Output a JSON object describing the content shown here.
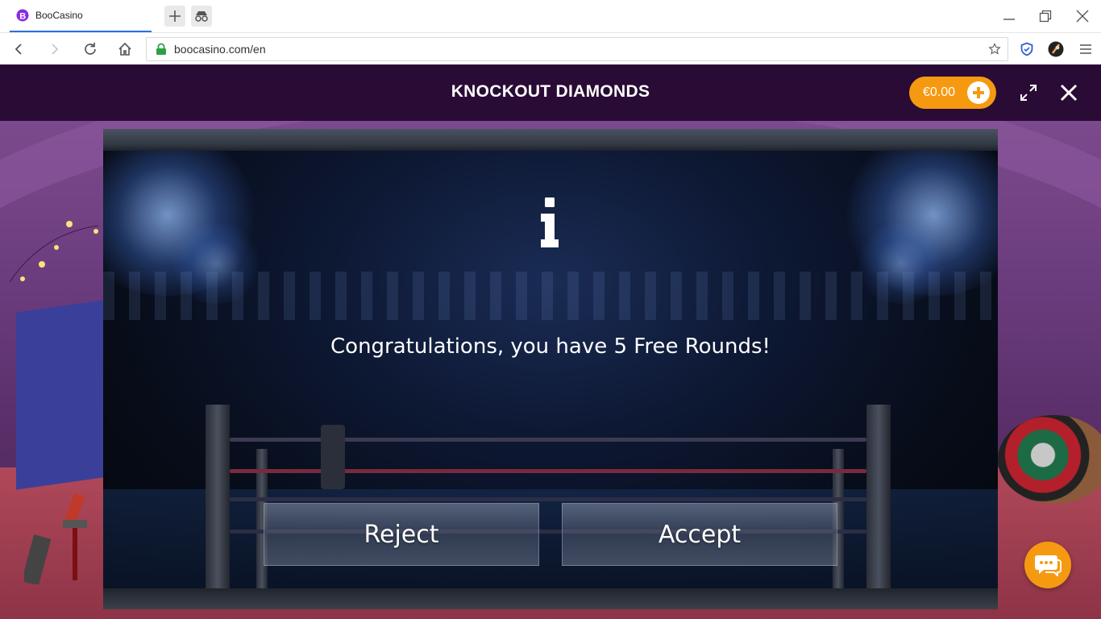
{
  "browser": {
    "tab_title": "BooCasino",
    "url": "boocasino.com/en"
  },
  "game": {
    "title": "KNOCKOUT DIAMONDS",
    "balance": "€0.00"
  },
  "dialog": {
    "message": "Congratulations, you have 5 Free Rounds!",
    "reject_label": "Reject",
    "accept_label": "Accept"
  },
  "colors": {
    "header_bg": "#2a0b36",
    "accent": "#f59a10",
    "tab_indicator": "#2b6ee6"
  },
  "icons": [
    "boocasino-favicon",
    "new-tab-icon",
    "private-tab-icon",
    "minimize-icon",
    "restore-icon",
    "close-window-icon",
    "back-icon",
    "forward-icon",
    "reload-icon",
    "home-icon",
    "lock-icon",
    "bookmark-star-icon",
    "shield-icon",
    "profile-avatar",
    "menu-icon",
    "plus-icon",
    "fullscreen-icon",
    "close-game-icon",
    "info-icon",
    "chat-icon"
  ]
}
